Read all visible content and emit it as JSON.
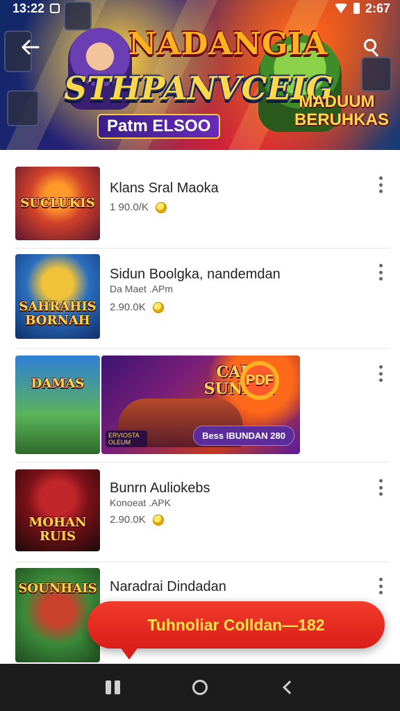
{
  "status_bar": {
    "time": "13:22",
    "right_text": "2:67"
  },
  "hero": {
    "title_line1": "NADANGIA",
    "title_line2": "STHPANVCEIG",
    "title_line3": "Patm ELSOO",
    "badge_text": "MADUUM BERUHKAS",
    "back_icon": "arrow-left-icon",
    "search_icon": "search-icon"
  },
  "apps": [
    {
      "thumb_text": "SUCLUKIS",
      "title": "Klans Sral Maoka",
      "subtitle": "",
      "meta": "1 90.0/K"
    },
    {
      "thumb_text": "SAHRAHIS BORNAH",
      "title": "Sidun Boolgka, nandemdan",
      "subtitle": "Da Maet .APm",
      "meta": "2.90.0K"
    },
    {
      "thumb_text": "DAMAS",
      "title": "",
      "subtitle": "",
      "meta": "",
      "banner": {
        "title": "CAPS SUNIAN",
        "badge": "PDF",
        "pill": "Bess IBUNDAN 280",
        "small_label": "ERVIOSTA OLEUM"
      }
    },
    {
      "thumb_text": "MOHAN RUIS",
      "title": "Bunrn Auliokebs",
      "subtitle": "Konoeat .APK",
      "meta": "2.90.0K"
    },
    {
      "thumb_text": "SOUNHAIS",
      "title": "Naradrai Dindadan",
      "subtitle": "",
      "meta": ""
    }
  ],
  "toast": {
    "text": "Tuhnoliar Colldan—182"
  },
  "colors": {
    "toast_bg": "#e0261f",
    "toast_text": "#ffe34d",
    "navbar_bg": "#1c1c1c"
  }
}
